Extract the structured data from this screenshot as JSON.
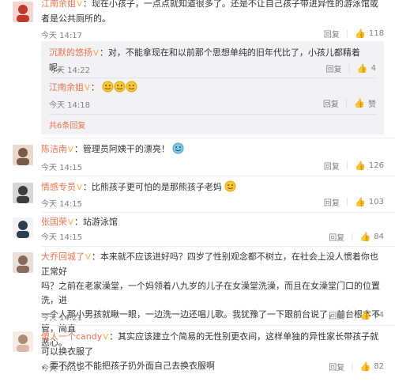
{
  "comments": [
    {
      "name": "江南余姐",
      "text": "：现在小孩子，一点点就知道很多了。还是不让自己孩子带进异性的游泳馆或者是公共厕所的。",
      "time": "今天 14:17",
      "reply_label": "回复",
      "like_count": "118",
      "avatar_color": "#c0392b"
    },
    {
      "name": "陈洁南",
      "text": "：管理员阿姨干的漂亮！",
      "time": "今天 14:15",
      "reply_label": "回复",
      "like_count": "126",
      "avatar_color": "#7a5a48"
    },
    {
      "name": "情感专员",
      "text": "：比熊孩子更可怕的是那熊孩子老妈",
      "time": "今天 14:15",
      "reply_label": "回复",
      "like_count": "103",
      "avatar_color": "#3b3b3b"
    },
    {
      "name": "张国荣",
      "text": "：站游泳馆",
      "time": "今天 14:15",
      "reply_label": "回复",
      "like_count": "84",
      "avatar_color": "#2d3e50"
    },
    {
      "name": "大乔回城了",
      "text_lines": [
        "：本来就不应该进好吗？四岁了性别观念都不树立，在社会上没人惯着你也正常好",
        "吗？之前在老家澡堂，一个妈领着八九岁的儿子在女澡堂洗澡，而且在女澡堂门口的位置洗，进",
        "一个人那小男孩就瞅一眼，一边洗一边还唱儿歌。我犹豫了一下跟前台说了，前台根本不管，简直",
        "恶心。"
      ],
      "time": "今天 14:21",
      "reply_label": "回复",
      "like_count": "84",
      "avatar_color": "#8a6a5a"
    },
    {
      "name": "傻人一个candy",
      "text_lines": [
        "：其实应该建立个简易的无性别更衣间，这样单独的异性家长带孩子就可以换衣服了",
        "，要不然也不能把孩子扔外面自己去换衣服啊"
      ],
      "time": "今天 14:19",
      "reply_label": "回复",
      "like_count": "82",
      "avatar_color": "#d9b8a8"
    }
  ],
  "replies": [
    {
      "name": "沉默的悠扬",
      "text": "：对，不能拿现在和以前那个思想单纯的旧年代比了，小孩儿都精着呢。",
      "time": "今天 14:22",
      "reply_label": "回复",
      "like_count": "4"
    },
    {
      "name": "江南余姐",
      "text": "：",
      "time": "今天 14:18",
      "reply_label": "回复",
      "like_label": "赞"
    }
  ],
  "more_replies": "共6条回复",
  "vip_badge": "V",
  "icons": {
    "like": "thumbs-up-icon",
    "emoji": "smiley-icon"
  },
  "colors": {
    "name": "#eb7350",
    "meta": "#808080",
    "reply_bg": "#f2f2f5"
  }
}
